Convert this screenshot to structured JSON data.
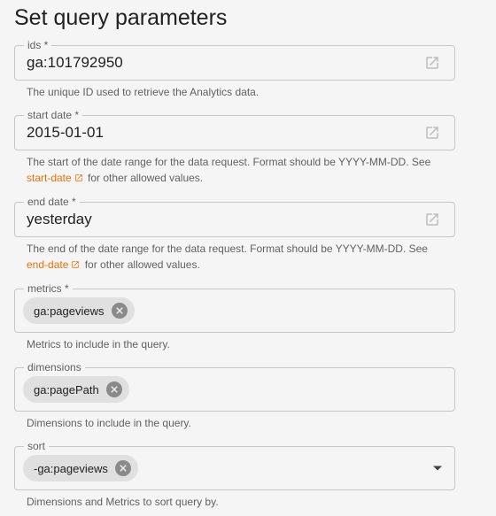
{
  "page": {
    "title": "Set query parameters"
  },
  "fields": {
    "ids": {
      "label": "ids *",
      "value": "ga:101792950",
      "help": "The unique ID used to retrieve the Analytics data."
    },
    "start_date": {
      "label": "start date *",
      "value": "2015-01-01",
      "help": "The start of the date range for the data request. Format should be YYYY-MM-DD. See",
      "link": "start-date",
      "help_after": "for other allowed values."
    },
    "end_date": {
      "label": "end date *",
      "value": "yesterday",
      "help": "The end of the date range for the data request. Format should be YYYY-MM-DD. See",
      "link": "end-date",
      "help_after": "for other allowed values."
    },
    "metrics": {
      "label": "metrics *",
      "chip": "ga:pageviews",
      "help": "Metrics to include in the query."
    },
    "dimensions": {
      "label": "dimensions",
      "chip": "ga:pagePath",
      "help": "Dimensions to include in the query."
    },
    "sort": {
      "label": "sort",
      "chip": "-ga:pageviews",
      "help": "Dimensions and Metrics to sort query by."
    }
  },
  "icons": {
    "external": "open-in-new-icon",
    "chip_remove": "cancel-icon",
    "dropdown": "arrow-drop-down-icon"
  },
  "colors": {
    "link": "#e8710a",
    "chip": "#e0e0e0",
    "background": "#f5f5f5"
  }
}
